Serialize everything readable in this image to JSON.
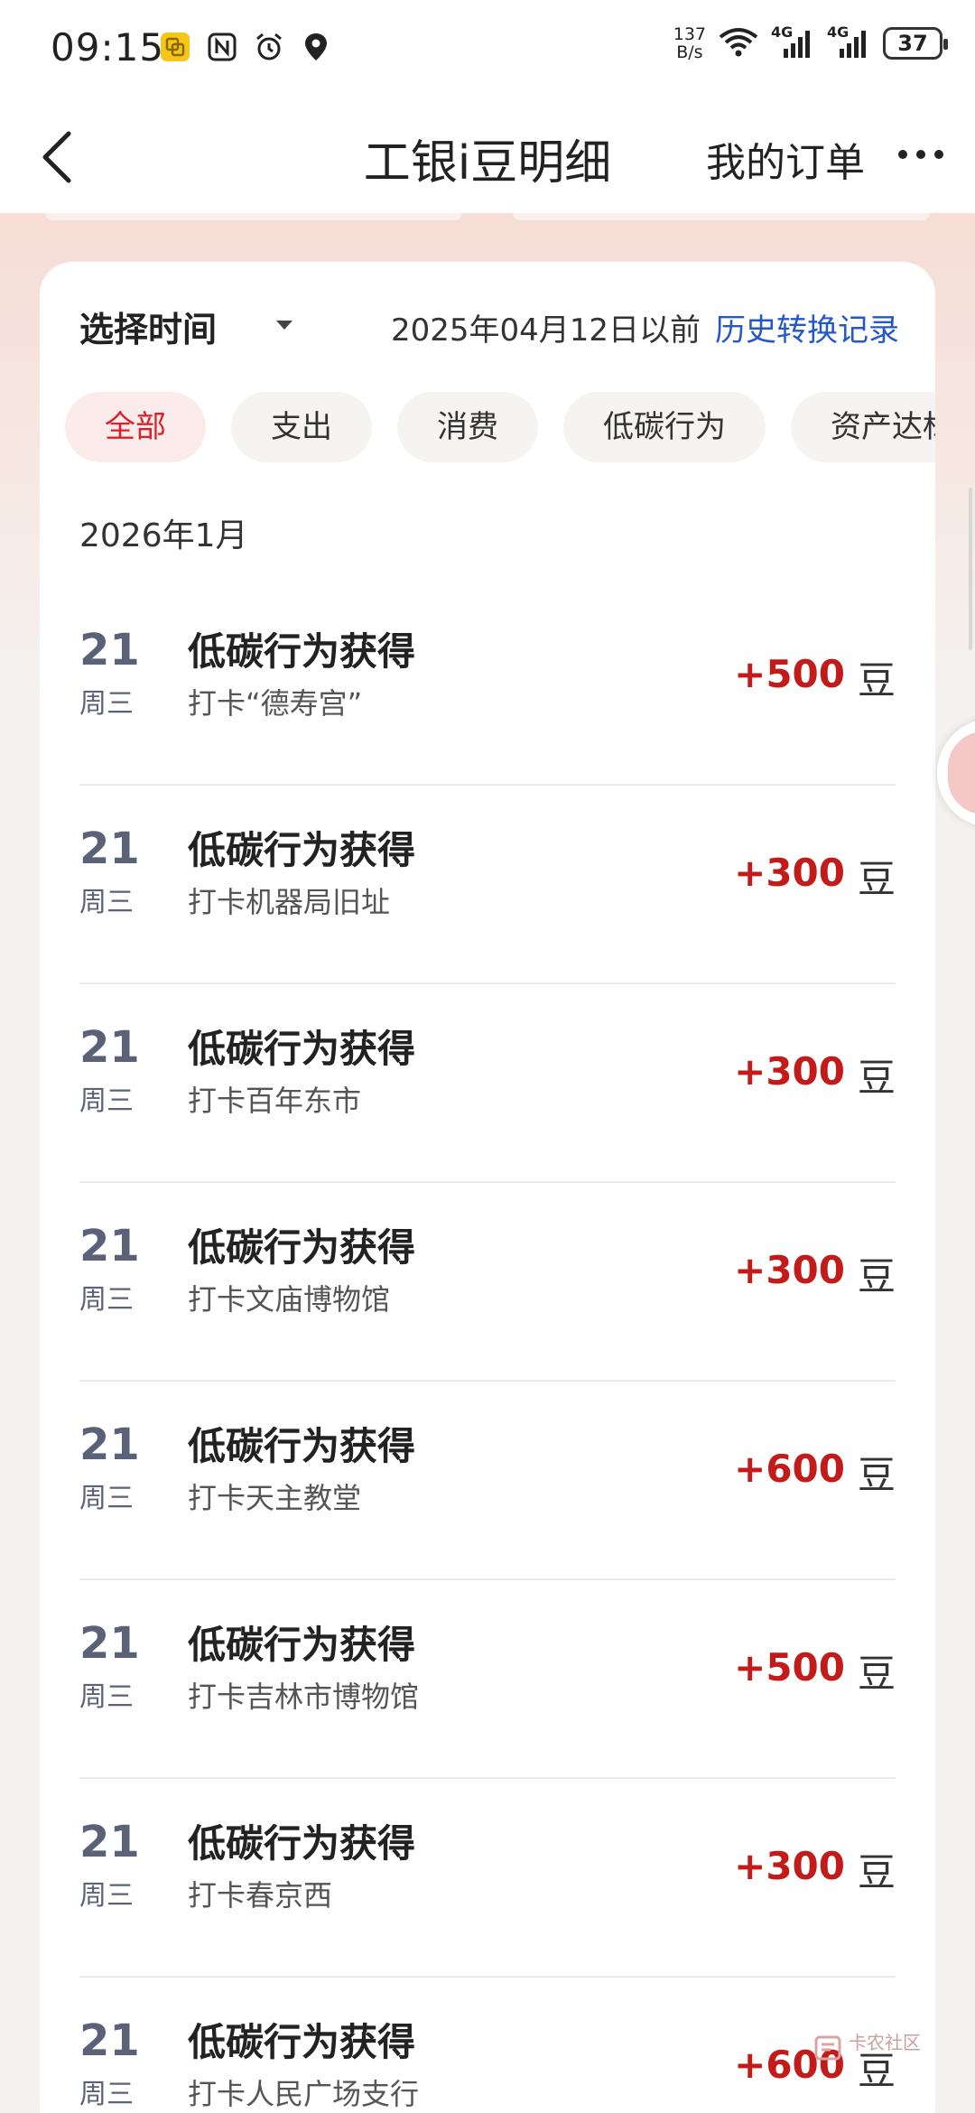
{
  "status_bar": {
    "time": "09:15",
    "net_rate": "137",
    "net_rate_unit": "B/s",
    "signal1_label": "4G",
    "signal2_label": "4G",
    "battery": "37",
    "icons": [
      "app-notification-icon",
      "nfc-icon",
      "alarm-icon",
      "location-icon",
      "wifi-icon",
      "signal-icon",
      "battery-icon"
    ]
  },
  "nav": {
    "title": "工银i豆明细",
    "orders_label": "我的订单",
    "back_icon": "chevron-left-icon",
    "more_icon": "more-dots-icon"
  },
  "filter": {
    "select_time_label": "选择时间",
    "date_note": "2025年04月12日以前",
    "history_link": "历史转换记录"
  },
  "tabs": [
    {
      "label": "全部",
      "active": true
    },
    {
      "label": "支出",
      "active": false
    },
    {
      "label": "消费",
      "active": false
    },
    {
      "label": "低碳行为",
      "active": false
    },
    {
      "label": "资产达标",
      "active": false
    }
  ],
  "month_header": "2026年1月",
  "records": [
    {
      "day": "21",
      "weekday": "周三",
      "title": "低碳行为获得",
      "subtitle": "打卡“德寿宫”",
      "amount": "+500",
      "unit": "豆"
    },
    {
      "day": "21",
      "weekday": "周三",
      "title": "低碳行为获得",
      "subtitle": "打卡机器局旧址",
      "amount": "+300",
      "unit": "豆"
    },
    {
      "day": "21",
      "weekday": "周三",
      "title": "低碳行为获得",
      "subtitle": "打卡百年东市",
      "amount": "+300",
      "unit": "豆"
    },
    {
      "day": "21",
      "weekday": "周三",
      "title": "低碳行为获得",
      "subtitle": "打卡文庙博物馆",
      "amount": "+300",
      "unit": "豆"
    },
    {
      "day": "21",
      "weekday": "周三",
      "title": "低碳行为获得",
      "subtitle": "打卡天主教堂",
      "amount": "+600",
      "unit": "豆"
    },
    {
      "day": "21",
      "weekday": "周三",
      "title": "低碳行为获得",
      "subtitle": "打卡吉林市博物馆",
      "amount": "+500",
      "unit": "豆"
    },
    {
      "day": "21",
      "weekday": "周三",
      "title": "低碳行为获得",
      "subtitle": "打卡春京西",
      "amount": "+300",
      "unit": "豆"
    },
    {
      "day": "21",
      "weekday": "周三",
      "title": "低碳行为获得",
      "subtitle": "打卡人民广场支行",
      "amount": "+600",
      "unit": "豆"
    }
  ],
  "watermark": {
    "text": "卡农社区"
  },
  "colors": {
    "accent_red": "#d9212c",
    "amount_red": "#c31a1a",
    "link_blue": "#2458c6",
    "day_gray_blue": "#5b6278"
  }
}
